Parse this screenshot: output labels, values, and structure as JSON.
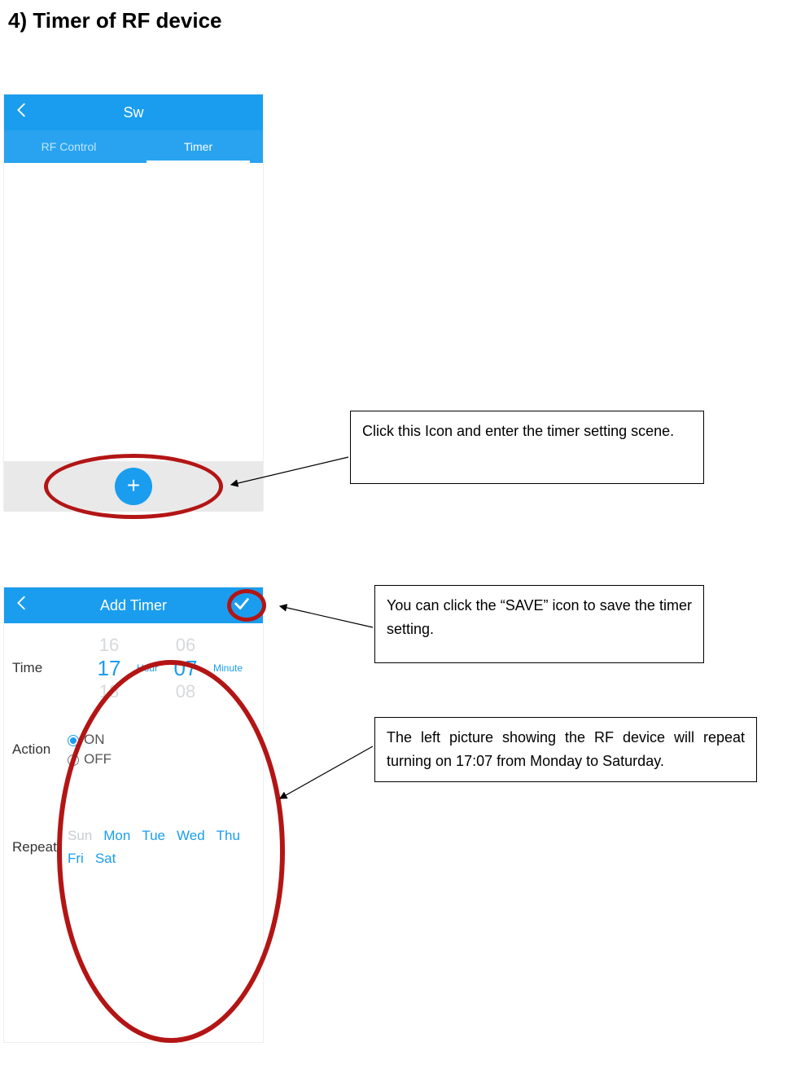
{
  "heading": "4)  Timer of RF device",
  "shot1": {
    "title": "Sw",
    "tab_rf": "RF Control",
    "tab_timer": "Timer"
  },
  "card1": "Click this Icon and enter the timer setting scene.",
  "shot2": {
    "title": "Add Timer",
    "time_label": "Time",
    "action_label": "Action",
    "repeat_label": "Repeat",
    "hour_prev": "16",
    "hour_sel": "17",
    "hour_next": "18",
    "min_prev": "06",
    "min_sel": "07",
    "min_next": "08",
    "unit_hour": "Hour",
    "unit_min": "Minute",
    "action_on": "ON",
    "action_off": "OFF",
    "days": [
      {
        "label": "Sun",
        "on": false
      },
      {
        "label": "Mon",
        "on": true
      },
      {
        "label": "Tue",
        "on": true
      },
      {
        "label": "Wed",
        "on": true
      },
      {
        "label": "Thu",
        "on": true
      },
      {
        "label": "Fri",
        "on": true
      },
      {
        "label": "Sat",
        "on": true
      }
    ]
  },
  "card2": "You can click the “SAVE” icon to save the timer setting.",
  "card3": "The left picture showing the RF device will repeat turning on 17:07 from Monday to Saturday."
}
